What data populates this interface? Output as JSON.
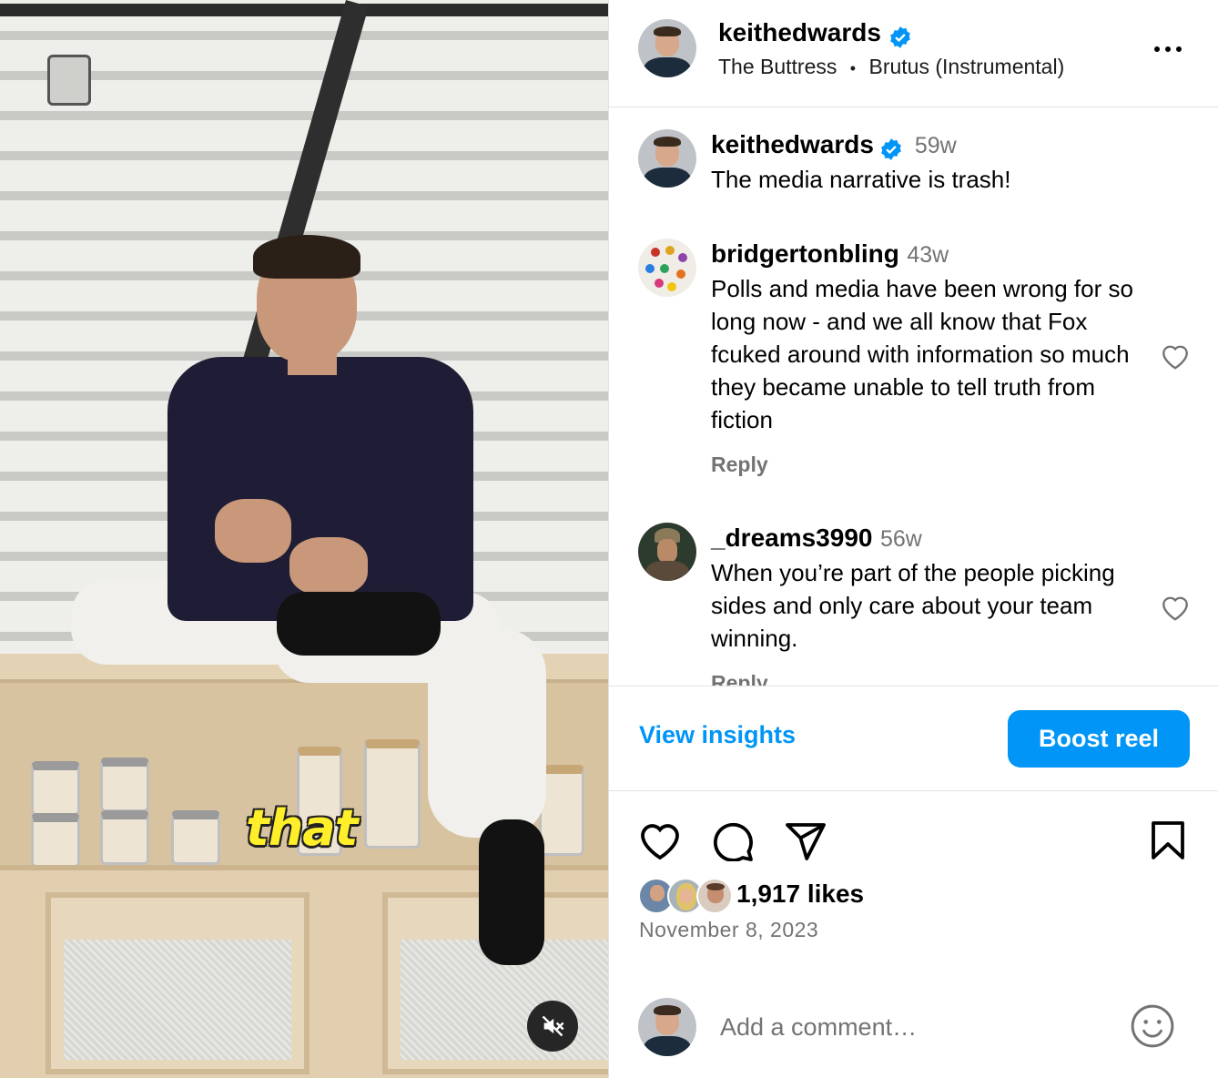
{
  "media": {
    "caption_word": "that",
    "mute_icon": "muted-speaker-icon"
  },
  "post": {
    "username": "keithedwards",
    "verified": true,
    "audio_artist": "The Buttress",
    "audio_separator": "•",
    "audio_track": "Brutus (Instrumental)",
    "options_icon": "more-horizontal-icon"
  },
  "comments": [
    {
      "username": "keithedwards",
      "verified": true,
      "age": "59w",
      "text": "The media narrative is trash!"
    },
    {
      "username": "bridgertonbling",
      "age": "43w",
      "text": "Polls and media have been wrong for so long now - and we all know that Fox fcuked around with information so much they became unable to tell truth from fiction",
      "reply_label": "Reply"
    },
    {
      "username": "_dreams3990",
      "age": "56w",
      "text": "When you’re part of the people picking sides and only care about your team winning.",
      "reply_label": "Reply"
    }
  ],
  "insights": {
    "view_label": "View insights",
    "boost_label": "Boost reel"
  },
  "actions": {
    "likes": "1,917 likes",
    "date": "November 8, 2023",
    "icons": [
      "heart-icon",
      "comment-icon",
      "share-icon",
      "bookmark-icon"
    ]
  },
  "composer": {
    "placeholder": "Add a comment…",
    "emoji_icon": "smiley-icon"
  },
  "colors": {
    "accent": "#0095f6",
    "verified_badge": "#0095f6",
    "secondary_text": "#737373",
    "caption_yellow": "#ffef2a"
  }
}
